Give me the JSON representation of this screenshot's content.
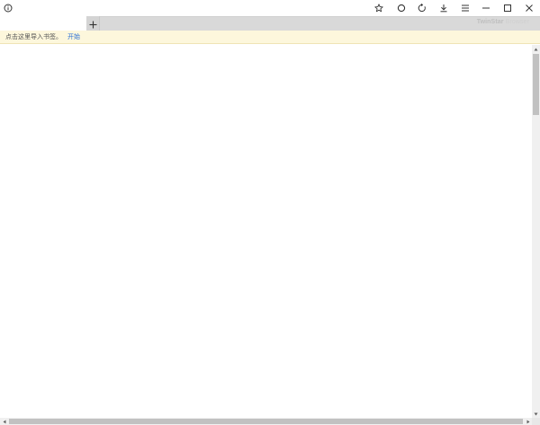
{
  "titlebar": {
    "icons": [
      "info-icon",
      "star-icon",
      "circle-icon",
      "reload-icon",
      "download-icon",
      "menu-icon",
      "minimize-icon",
      "maximize-icon",
      "close-icon"
    ]
  },
  "tabstrip": {
    "new_tab_label": "+",
    "brand_bold": "TwinStar",
    "brand_light": "Browser"
  },
  "infobar": {
    "message": "点击这里导入书签。",
    "link": "开始"
  },
  "colors": {
    "infobar_bg": "#fdf7dc",
    "link": "#2a6fd6",
    "tabstrip_bg": "#d9d9d9",
    "scrollbar_thumb": "#c1c1c1"
  }
}
